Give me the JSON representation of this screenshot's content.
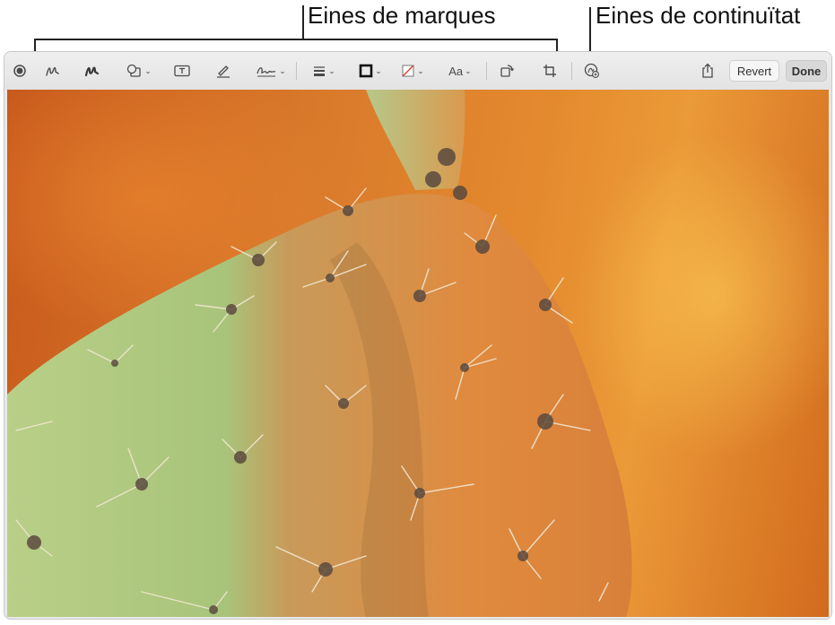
{
  "callouts": {
    "markup": "Eines de marques",
    "continuity": "Eines de continuïtat"
  },
  "toolbar": {
    "tools": [
      {
        "icon": "sketch-toggle-icon"
      },
      {
        "icon": "sketch-icon"
      },
      {
        "icon": "draw-icon"
      },
      {
        "icon": "shapes-icon"
      },
      {
        "icon": "text-box-icon"
      },
      {
        "icon": "highlight-icon"
      },
      {
        "icon": "signature-icon"
      },
      {
        "icon": "line-style-icon"
      },
      {
        "icon": "border-color-icon"
      },
      {
        "icon": "fill-color-icon"
      },
      {
        "icon": "text-style-icon",
        "label": "Aa"
      },
      {
        "icon": "rotate-icon"
      },
      {
        "icon": "crop-icon"
      },
      {
        "icon": "continuity-icon"
      },
      {
        "icon": "share-icon"
      }
    ],
    "revert_label": "Revert",
    "done_label": "Done"
  },
  "colors": {
    "toolbar_bg": "#e9e9e9",
    "photo_orange": "#d97a2b",
    "cactus_green": "#a9c57a"
  }
}
